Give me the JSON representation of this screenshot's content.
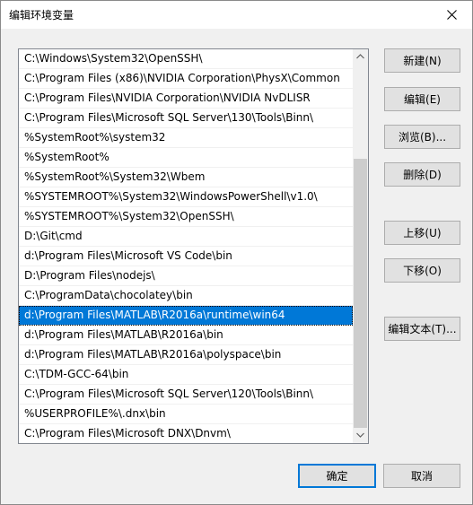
{
  "window": {
    "title": "编辑环境变量"
  },
  "path_list": {
    "items": [
      "C:\\Windows\\System32\\OpenSSH\\",
      "C:\\Program Files (x86)\\NVIDIA Corporation\\PhysX\\Common",
      "C:\\Program Files\\NVIDIA Corporation\\NVIDIA NvDLISR",
      "C:\\Program Files\\Microsoft SQL Server\\130\\Tools\\Binn\\",
      "%SystemRoot%\\system32",
      "%SystemRoot%",
      "%SystemRoot%\\System32\\Wbem",
      "%SYSTEMROOT%\\System32\\WindowsPowerShell\\v1.0\\",
      "%SYSTEMROOT%\\System32\\OpenSSH\\",
      "D:\\Git\\cmd",
      "d:\\Program Files\\Microsoft VS Code\\bin",
      "D:\\Program Files\\nodejs\\",
      "C:\\ProgramData\\chocolatey\\bin",
      "d:\\Program Files\\MATLAB\\R2016a\\runtime\\win64",
      "d:\\Program Files\\MATLAB\\R2016a\\bin",
      "d:\\Program Files\\MATLAB\\R2016a\\polyspace\\bin",
      "C:\\TDM-GCC-64\\bin",
      "C:\\Program Files\\Microsoft SQL Server\\120\\Tools\\Binn\\",
      "%USERPROFILE%\\.dnx\\bin",
      "C:\\Program Files\\Microsoft DNX\\Dnvm\\"
    ],
    "selected_index": 13
  },
  "buttons": {
    "new": "新建(N)",
    "edit": "编辑(E)",
    "browse": "浏览(B)...",
    "delete": "删除(D)",
    "move_up": "上移(U)",
    "move_down": "下移(O)",
    "edit_text": "编辑文本(T)...",
    "ok": "确定",
    "cancel": "取消"
  },
  "icons": {
    "close": "close-icon",
    "scroll_up": "chevron-up-icon",
    "scroll_down": "chevron-down-icon"
  },
  "colors": {
    "selection": "#0078d7",
    "dialog_bg": "#f0f0f0"
  }
}
